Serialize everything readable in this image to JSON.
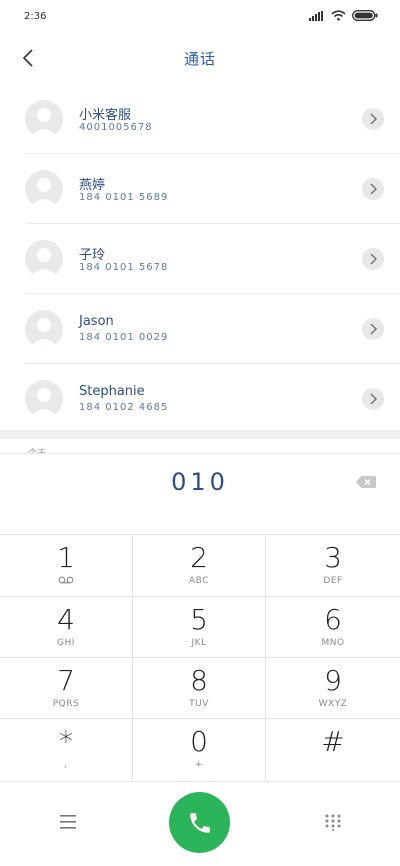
{
  "status": {
    "time": "2:36"
  },
  "header": {
    "title": "通话"
  },
  "contacts": [
    {
      "name": "小米客服",
      "number": "4001005678"
    },
    {
      "name": "燕婷",
      "number": "184 0101 5689"
    },
    {
      "name": "子玲",
      "number": "184 0101 5678"
    },
    {
      "name": "Jason",
      "number": "184 0101 0029"
    },
    {
      "name": "Stephanie",
      "number": "184 0102 4685"
    }
  ],
  "peek_label": "今天",
  "input": {
    "value": "010"
  },
  "keypad": [
    {
      "digit": "1",
      "letters": ""
    },
    {
      "digit": "2",
      "letters": "ABC"
    },
    {
      "digit": "3",
      "letters": "DEF"
    },
    {
      "digit": "4",
      "letters": "GHI"
    },
    {
      "digit": "5",
      "letters": "JKL"
    },
    {
      "digit": "6",
      "letters": "MNO"
    },
    {
      "digit": "7",
      "letters": "PQRS"
    },
    {
      "digit": "8",
      "letters": "TUV"
    },
    {
      "digit": "9",
      "letters": "WXYZ"
    },
    {
      "digit": "*",
      "letters": ","
    },
    {
      "digit": "0",
      "letters": "+"
    },
    {
      "digit": "#",
      "letters": ""
    }
  ],
  "colors": {
    "accent": "#2d4e86",
    "call": "#2bb45a"
  },
  "icons": {
    "back": "chevron-left-icon",
    "chevron": "chevron-right-icon",
    "backspace": "backspace-icon",
    "voicemail": "voicemail-icon",
    "menu": "menu-icon",
    "call": "phone-icon",
    "dialpad": "dialpad-icon"
  }
}
